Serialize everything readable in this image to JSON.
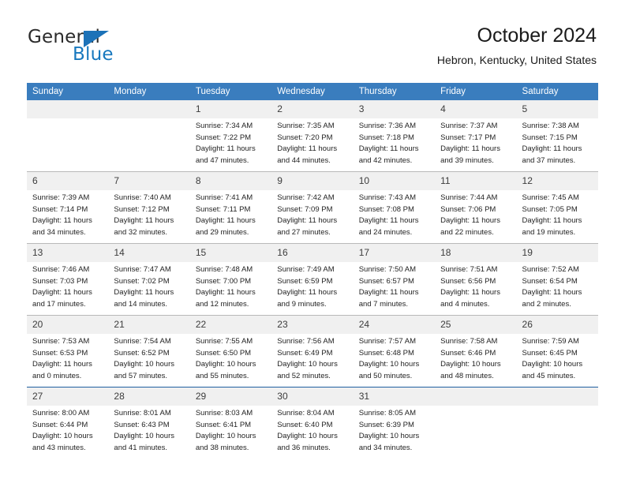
{
  "brand": {
    "name_top": "General",
    "name_bottom": "Blue"
  },
  "header": {
    "title": "October 2024",
    "subtitle": "Hebron, Kentucky, United States"
  },
  "colors": {
    "header_blue": "#3a7dbe",
    "brand_blue": "#1878be",
    "daynum_band": "#f0f0f0",
    "row_rule": "#b9b9b9",
    "last_row_rule": "#1f5fa0"
  },
  "weekday_headers": [
    "Sunday",
    "Monday",
    "Tuesday",
    "Wednesday",
    "Thursday",
    "Friday",
    "Saturday"
  ],
  "labels": {
    "sunrise_prefix": "Sunrise:",
    "sunset_prefix": "Sunset:",
    "daylight_prefix": "Daylight:"
  },
  "weeks": [
    [
      {
        "day": "",
        "empty": true,
        "line1": "",
        "line2": "",
        "line3": "",
        "line4": ""
      },
      {
        "day": "",
        "empty": true,
        "line1": "",
        "line2": "",
        "line3": "",
        "line4": ""
      },
      {
        "day": "1",
        "empty": false,
        "line1": "Sunrise: 7:34 AM",
        "line2": "Sunset: 7:22 PM",
        "line3": "Daylight: 11 hours",
        "line4": "and 47 minutes."
      },
      {
        "day": "2",
        "empty": false,
        "line1": "Sunrise: 7:35 AM",
        "line2": "Sunset: 7:20 PM",
        "line3": "Daylight: 11 hours",
        "line4": "and 44 minutes."
      },
      {
        "day": "3",
        "empty": false,
        "line1": "Sunrise: 7:36 AM",
        "line2": "Sunset: 7:18 PM",
        "line3": "Daylight: 11 hours",
        "line4": "and 42 minutes."
      },
      {
        "day": "4",
        "empty": false,
        "line1": "Sunrise: 7:37 AM",
        "line2": "Sunset: 7:17 PM",
        "line3": "Daylight: 11 hours",
        "line4": "and 39 minutes."
      },
      {
        "day": "5",
        "empty": false,
        "line1": "Sunrise: 7:38 AM",
        "line2": "Sunset: 7:15 PM",
        "line3": "Daylight: 11 hours",
        "line4": "and 37 minutes."
      }
    ],
    [
      {
        "day": "6",
        "empty": false,
        "line1": "Sunrise: 7:39 AM",
        "line2": "Sunset: 7:14 PM",
        "line3": "Daylight: 11 hours",
        "line4": "and 34 minutes."
      },
      {
        "day": "7",
        "empty": false,
        "line1": "Sunrise: 7:40 AM",
        "line2": "Sunset: 7:12 PM",
        "line3": "Daylight: 11 hours",
        "line4": "and 32 minutes."
      },
      {
        "day": "8",
        "empty": false,
        "line1": "Sunrise: 7:41 AM",
        "line2": "Sunset: 7:11 PM",
        "line3": "Daylight: 11 hours",
        "line4": "and 29 minutes."
      },
      {
        "day": "9",
        "empty": false,
        "line1": "Sunrise: 7:42 AM",
        "line2": "Sunset: 7:09 PM",
        "line3": "Daylight: 11 hours",
        "line4": "and 27 minutes."
      },
      {
        "day": "10",
        "empty": false,
        "line1": "Sunrise: 7:43 AM",
        "line2": "Sunset: 7:08 PM",
        "line3": "Daylight: 11 hours",
        "line4": "and 24 minutes."
      },
      {
        "day": "11",
        "empty": false,
        "line1": "Sunrise: 7:44 AM",
        "line2": "Sunset: 7:06 PM",
        "line3": "Daylight: 11 hours",
        "line4": "and 22 minutes."
      },
      {
        "day": "12",
        "empty": false,
        "line1": "Sunrise: 7:45 AM",
        "line2": "Sunset: 7:05 PM",
        "line3": "Daylight: 11 hours",
        "line4": "and 19 minutes."
      }
    ],
    [
      {
        "day": "13",
        "empty": false,
        "line1": "Sunrise: 7:46 AM",
        "line2": "Sunset: 7:03 PM",
        "line3": "Daylight: 11 hours",
        "line4": "and 17 minutes."
      },
      {
        "day": "14",
        "empty": false,
        "line1": "Sunrise: 7:47 AM",
        "line2": "Sunset: 7:02 PM",
        "line3": "Daylight: 11 hours",
        "line4": "and 14 minutes."
      },
      {
        "day": "15",
        "empty": false,
        "line1": "Sunrise: 7:48 AM",
        "line2": "Sunset: 7:00 PM",
        "line3": "Daylight: 11 hours",
        "line4": "and 12 minutes."
      },
      {
        "day": "16",
        "empty": false,
        "line1": "Sunrise: 7:49 AM",
        "line2": "Sunset: 6:59 PM",
        "line3": "Daylight: 11 hours",
        "line4": "and 9 minutes."
      },
      {
        "day": "17",
        "empty": false,
        "line1": "Sunrise: 7:50 AM",
        "line2": "Sunset: 6:57 PM",
        "line3": "Daylight: 11 hours",
        "line4": "and 7 minutes."
      },
      {
        "day": "18",
        "empty": false,
        "line1": "Sunrise: 7:51 AM",
        "line2": "Sunset: 6:56 PM",
        "line3": "Daylight: 11 hours",
        "line4": "and 4 minutes."
      },
      {
        "day": "19",
        "empty": false,
        "line1": "Sunrise: 7:52 AM",
        "line2": "Sunset: 6:54 PM",
        "line3": "Daylight: 11 hours",
        "line4": "and 2 minutes."
      }
    ],
    [
      {
        "day": "20",
        "empty": false,
        "line1": "Sunrise: 7:53 AM",
        "line2": "Sunset: 6:53 PM",
        "line3": "Daylight: 11 hours",
        "line4": "and 0 minutes."
      },
      {
        "day": "21",
        "empty": false,
        "line1": "Sunrise: 7:54 AM",
        "line2": "Sunset: 6:52 PM",
        "line3": "Daylight: 10 hours",
        "line4": "and 57 minutes."
      },
      {
        "day": "22",
        "empty": false,
        "line1": "Sunrise: 7:55 AM",
        "line2": "Sunset: 6:50 PM",
        "line3": "Daylight: 10 hours",
        "line4": "and 55 minutes."
      },
      {
        "day": "23",
        "empty": false,
        "line1": "Sunrise: 7:56 AM",
        "line2": "Sunset: 6:49 PM",
        "line3": "Daylight: 10 hours",
        "line4": "and 52 minutes."
      },
      {
        "day": "24",
        "empty": false,
        "line1": "Sunrise: 7:57 AM",
        "line2": "Sunset: 6:48 PM",
        "line3": "Daylight: 10 hours",
        "line4": "and 50 minutes."
      },
      {
        "day": "25",
        "empty": false,
        "line1": "Sunrise: 7:58 AM",
        "line2": "Sunset: 6:46 PM",
        "line3": "Daylight: 10 hours",
        "line4": "and 48 minutes."
      },
      {
        "day": "26",
        "empty": false,
        "line1": "Sunrise: 7:59 AM",
        "line2": "Sunset: 6:45 PM",
        "line3": "Daylight: 10 hours",
        "line4": "and 45 minutes."
      }
    ],
    [
      {
        "day": "27",
        "empty": false,
        "line1": "Sunrise: 8:00 AM",
        "line2": "Sunset: 6:44 PM",
        "line3": "Daylight: 10 hours",
        "line4": "and 43 minutes."
      },
      {
        "day": "28",
        "empty": false,
        "line1": "Sunrise: 8:01 AM",
        "line2": "Sunset: 6:43 PM",
        "line3": "Daylight: 10 hours",
        "line4": "and 41 minutes."
      },
      {
        "day": "29",
        "empty": false,
        "line1": "Sunrise: 8:03 AM",
        "line2": "Sunset: 6:41 PM",
        "line3": "Daylight: 10 hours",
        "line4": "and 38 minutes."
      },
      {
        "day": "30",
        "empty": false,
        "line1": "Sunrise: 8:04 AM",
        "line2": "Sunset: 6:40 PM",
        "line3": "Daylight: 10 hours",
        "line4": "and 36 minutes."
      },
      {
        "day": "31",
        "empty": false,
        "line1": "Sunrise: 8:05 AM",
        "line2": "Sunset: 6:39 PM",
        "line3": "Daylight: 10 hours",
        "line4": "and 34 minutes."
      },
      {
        "day": "",
        "empty": true,
        "line1": "",
        "line2": "",
        "line3": "",
        "line4": ""
      },
      {
        "day": "",
        "empty": true,
        "line1": "",
        "line2": "",
        "line3": "",
        "line4": ""
      }
    ]
  ]
}
